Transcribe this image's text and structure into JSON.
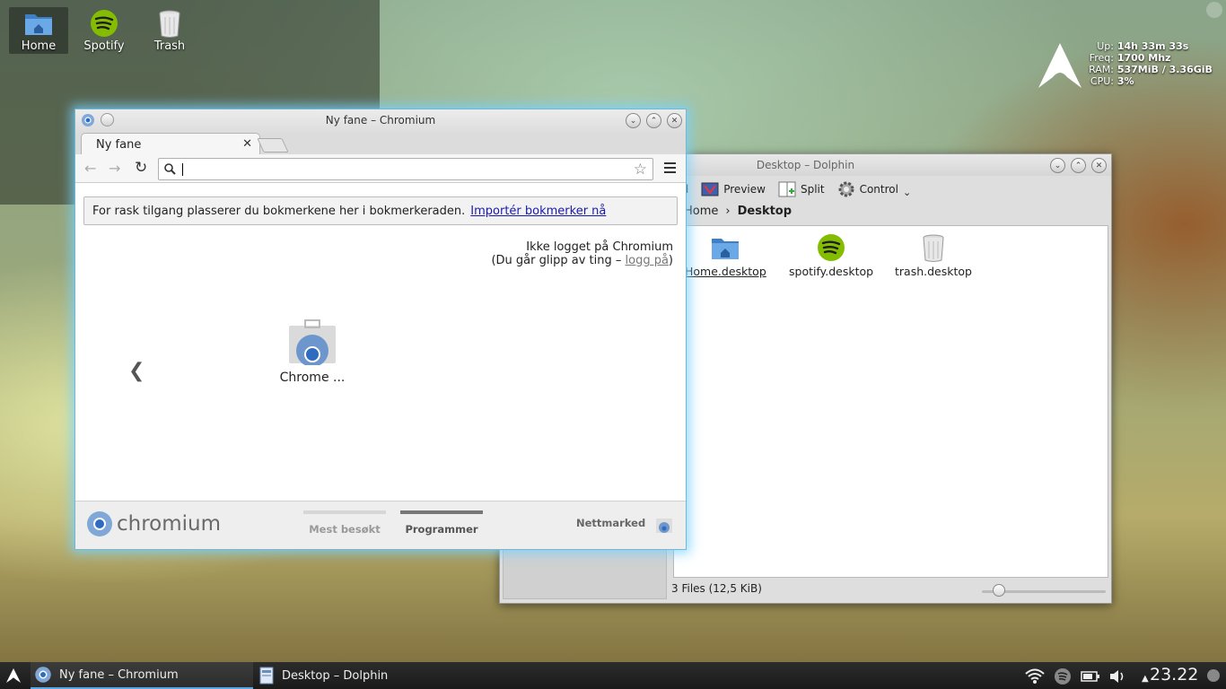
{
  "desktop": {
    "icons": [
      {
        "label": "Home"
      },
      {
        "label": "Spotify"
      },
      {
        "label": "Trash"
      }
    ]
  },
  "conky": {
    "up_label": "Up:",
    "up_value": "14h 33m 33s",
    "freq_label": "Freq:",
    "freq_value": "1700 Mhz",
    "ram_label": "RAM:",
    "ram_value": "537MiB / 3.36GiB",
    "cpu_label": "CPU:",
    "cpu_value": "3%"
  },
  "dolphin": {
    "title": "Desktop – Dolphin",
    "toolbar": {
      "find": "nd",
      "preview": "Preview",
      "split": "Split",
      "control": "Control"
    },
    "breadcrumb": {
      "parent": "Home",
      "current": "Desktop"
    },
    "files": [
      {
        "name": "Home.desktop"
      },
      {
        "name": "spotify.desktop"
      },
      {
        "name": "trash.desktop"
      }
    ],
    "status": "3 Files (12,5 KiB)",
    "zoom_level": 0.1
  },
  "chromium": {
    "title": "Ny fane – Chromium",
    "tab_label": "Ny fane",
    "omnibox_value": "",
    "bookmark_bar": {
      "text": "For rask tilgang plasserer du bokmerkene her i bokmerkeraden.",
      "link": "Importér bokmerker nå"
    },
    "login": {
      "line1": "Ikke logget på Chromium",
      "line2_prefix": "(Du går glipp av ting – ",
      "link": "logg på",
      "line2_suffix": ")"
    },
    "apps": [
      {
        "label": "Chrome ..."
      }
    ],
    "footer": {
      "brand": "chromium",
      "tab_most_visited": "Mest besøkt",
      "tab_apps": "Programmer",
      "store": "Nettmarked"
    }
  },
  "taskbar": {
    "tasks": [
      {
        "label": "Ny fane – Chromium"
      },
      {
        "label": "Desktop – Dolphin"
      }
    ],
    "clock": "23.22"
  },
  "colors": {
    "accent": "#5aa6e0",
    "chromium_glow": "#78d2ff",
    "spotify_green": "#84bd00",
    "link_blue": "#1a1aaa"
  }
}
